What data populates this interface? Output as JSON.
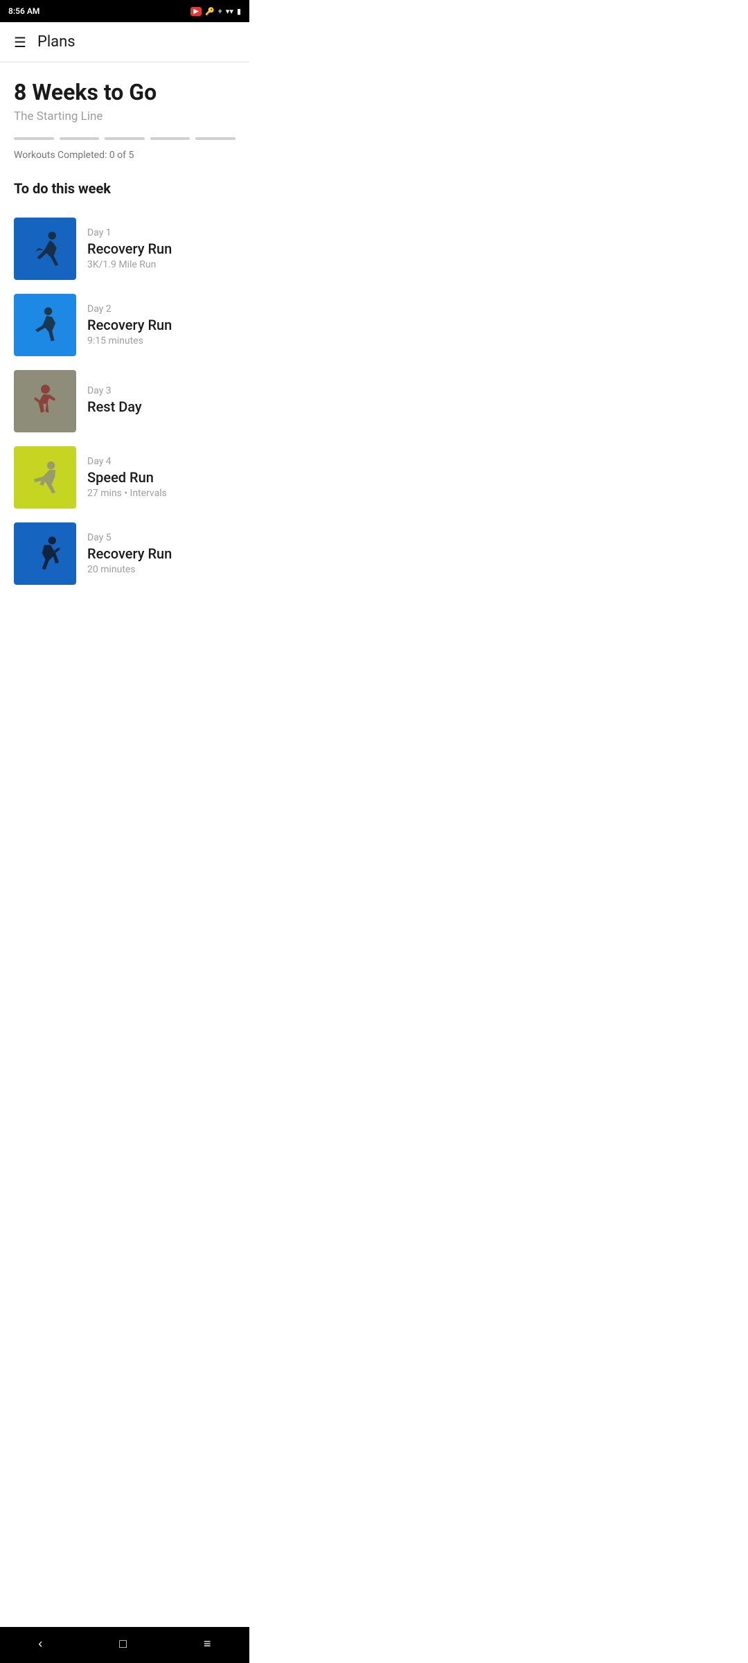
{
  "statusBar": {
    "time": "8:56 AM",
    "icons": [
      "video",
      "key",
      "bluetooth",
      "wifi",
      "battery"
    ]
  },
  "header": {
    "title": "Plans",
    "menuIcon": "hamburger-icon"
  },
  "plan": {
    "weeksTitle": "8 Weeks to Go",
    "subtitle": "The Starting Line",
    "progressBars": 5,
    "workoutsCompleted": "Workouts Completed: 0 of 5"
  },
  "section": {
    "title": "To do this week"
  },
  "workouts": [
    {
      "day": "Day 1",
      "name": "Recovery Run",
      "detail": "3K/1.9 Mile Run",
      "thumbClass": "thumb-blue",
      "figure": "runner1"
    },
    {
      "day": "Day 2",
      "name": "Recovery Run",
      "detail": "9:15 minutes",
      "thumbClass": "thumb-blue2",
      "figure": "runner2"
    },
    {
      "day": "Day 3",
      "name": "Rest Day",
      "detail": "",
      "thumbClass": "thumb-gray",
      "figure": "runner3"
    },
    {
      "day": "Day 4",
      "name": "Speed Run",
      "detail": "27 mins • Intervals",
      "thumbClass": "thumb-yellow",
      "figure": "runner4"
    },
    {
      "day": "Day 5",
      "name": "Recovery Run",
      "detail": "20 minutes",
      "thumbClass": "thumb-blue3",
      "figure": "runner5"
    }
  ],
  "bottomNav": {
    "backLabel": "‹",
    "homeLabel": "□",
    "menuLabel": "≡"
  }
}
